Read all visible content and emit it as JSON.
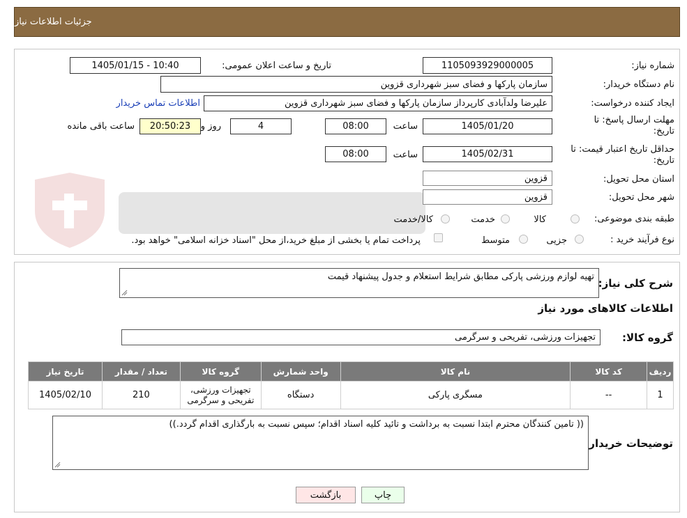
{
  "header": {
    "title": "جزئیات اطلاعات نیاز"
  },
  "form": {
    "need_number_label": "شماره نیاز:",
    "need_number": "1105093929000005",
    "announce_label": "تاریخ و ساعت اعلان عمومی:",
    "announce_value": "1405/01/15 - 10:40",
    "buyer_org_label": "نام دستگاه خریدار:",
    "buyer_org": "سازمان پارکها و فضای سبز شهرداری قزوین",
    "requester_label": "ایجاد کننده درخواست:",
    "requester": "علیرضا ولدآبادی کارپرداز سازمان پارکها و فضای سبز شهرداری قزوین",
    "contact_link": "اطلاعات تماس خریدار",
    "deadline_label_1": "مهلت ارسال پاسخ: تا",
    "deadline_label_2": "تاریخ:",
    "deadline_date": "1405/01/20",
    "time_label": "ساعت",
    "deadline_time": "08:00",
    "days_value": "4",
    "days_label": "روز و",
    "remaining_time": "20:50:23",
    "remaining_label": "ساعت باقی مانده",
    "validity_label_1": "حداقل تاریخ اعتبار قیمت: تا",
    "validity_label_2": "تاریخ:",
    "validity_date": "1405/02/31",
    "validity_time": "08:00",
    "province_label": "استان محل تحویل:",
    "province": "قزوین",
    "city_label": "شهر محل تحویل:",
    "city": "قزوین",
    "category_label": "طبقه بندی موضوعی:",
    "category_options": [
      "کالا",
      "خدمت",
      "کالا/خدمت"
    ],
    "process_label": "نوع فرآیند خرید :",
    "process_options": [
      "جزیی",
      "متوسط"
    ],
    "treasury_note": "پرداخت تمام یا بخشی از مبلغ خرید،از محل \"اسناد خزانه اسلامی\" خواهد بود."
  },
  "description": {
    "label": "شرح کلی نیاز:",
    "value": "تهیه لوازم ورزشی پارکی مطابق شرایط استعلام و جدول پیشنهاد قیمت"
  },
  "goods": {
    "section_title": "اطلاعات کالاهای مورد نیاز",
    "group_label": "گروه کالا:",
    "group_value": "تجهیزات ورزشی، تفریحی و سرگرمی",
    "columns": [
      "ردیف",
      "کد کالا",
      "نام کالا",
      "واحد شمارش",
      "گروه کالا",
      "تعداد / مقدار",
      "تاریخ نیاز"
    ],
    "rows": [
      [
        "1",
        "--",
        "مسگری پارکی",
        "دستگاه",
        "تجهیزات ورزشی، تفریحی و سرگرمی",
        "210",
        "1405/02/10"
      ]
    ]
  },
  "buyer_notes": {
    "label": "توضیحات خریدار:",
    "value": "(( تامین کنندگان محترم ابتدا نسبت به برداشت و تائید کلیه اسناد اقدام؛ سپس نسبت به بارگذاری اقدام گردد.))"
  },
  "buttons": {
    "print": "چاپ",
    "back": "بازگشت"
  },
  "colors": {
    "header": "#8b6b42",
    "table_header": "#7a7a7a",
    "print_button": "#eaffea",
    "back_button": "#ffe6e6",
    "remaining_bg": "#ffffcc",
    "link": "#1a3fb7"
  }
}
